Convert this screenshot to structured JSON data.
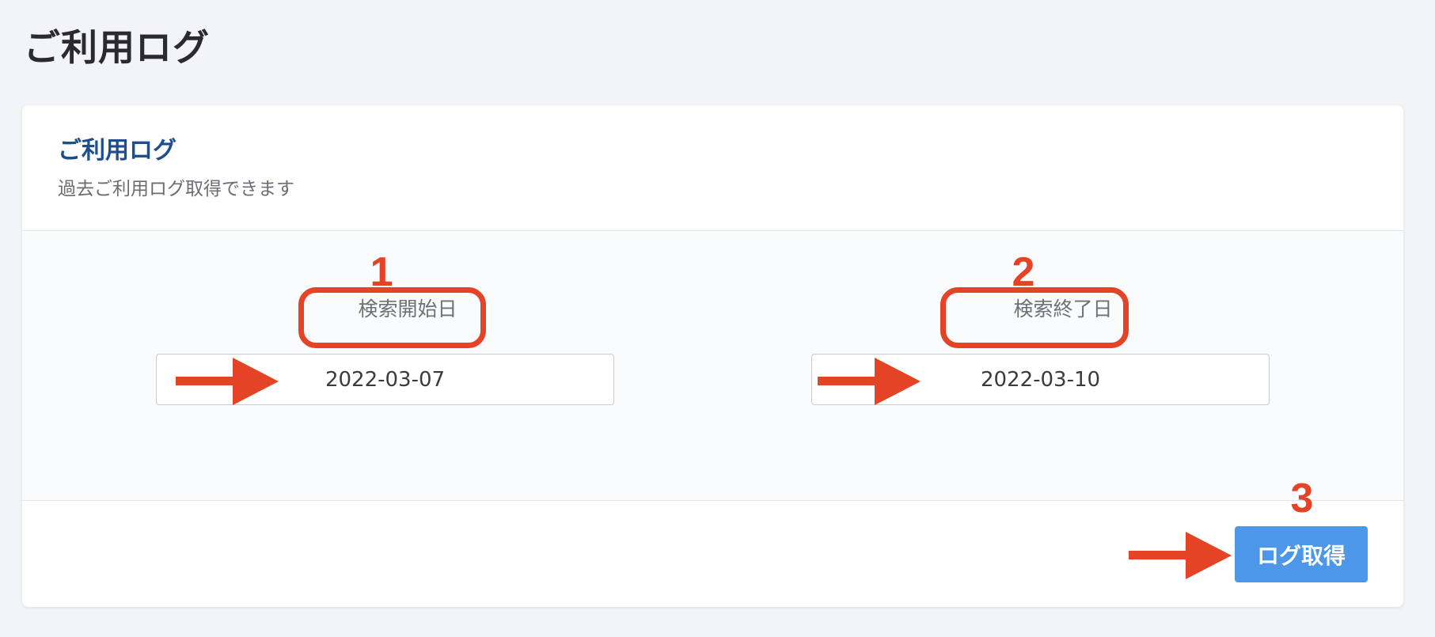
{
  "page": {
    "title": "ご利用ログ"
  },
  "card": {
    "title": "ご利用ログ",
    "subtitle": "過去ご利用ログ取得できます"
  },
  "search": {
    "start_label": "検索開始日",
    "start_value": "2022-03-07",
    "end_label": "検索終了日",
    "end_value": "2022-03-10"
  },
  "actions": {
    "fetch_label": "ログ取得"
  },
  "annotations": {
    "step1": "1",
    "step2": "2",
    "step3": "3",
    "color": "#e44326"
  },
  "colors": {
    "accent": "#4c97e8",
    "title": "#1f4e8e",
    "background": "#f3f4f8"
  }
}
